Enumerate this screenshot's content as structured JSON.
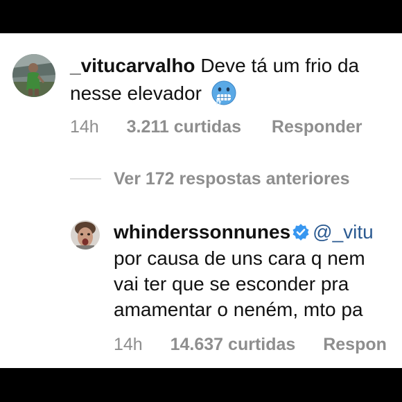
{
  "comment": {
    "username": "_vitucarvalho",
    "text_line1": "Deve tá um frio da",
    "text_line2": "nesse elevador",
    "emoji": "cold-face-emoji",
    "time": "14h",
    "likes": "3.211 curtidas",
    "reply_label": "Responder"
  },
  "view_more": "Ver 172 respostas anteriores",
  "reply": {
    "username": "whinderssonnunes",
    "verified": "verified-badge-icon",
    "mention": "@_vitu",
    "text_line1": "por causa de uns cara q nem",
    "text_line2": "vai ter que se esconder pra",
    "text_line3": "amamentar o neném, mto pa",
    "time": "14h",
    "likes": "14.637 curtidas",
    "reply_label": "Respon"
  },
  "colors": {
    "background": "#ffffff",
    "muted_text": "#8e8e8e",
    "mention": "#2b5a91",
    "verified": "#3897f0"
  }
}
